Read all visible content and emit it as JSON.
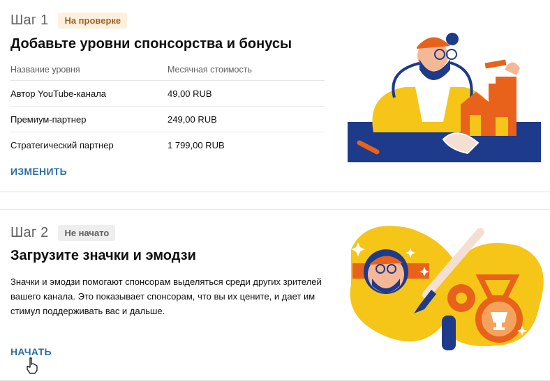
{
  "step1": {
    "step_label": "Шаг 1",
    "badge": "На проверке",
    "title": "Добавьте уровни спонсорства и бонусы",
    "table": {
      "headers": [
        "Название уровня",
        "Месячная стоимость"
      ],
      "rows": [
        [
          "Автор YouTube-канала",
          "49,00 RUB"
        ],
        [
          "Премиум-партнер",
          "249,00 RUB"
        ],
        [
          "Стратегический партнер",
          "1 799,00 RUB"
        ]
      ]
    },
    "action": "ИЗМЕНИТЬ"
  },
  "step2": {
    "step_label": "Шаг 2",
    "badge": "Не начато",
    "title": "Загрузите значки и эмодзи",
    "description": "Значки и эмодзи помогают спонсорам выделяться среди других зрителей вашего канала. Это показывает спонсорам, что вы их цените, и дает им стимул поддерживать вас и дальше.",
    "action": "НАЧАТЬ"
  },
  "colors": {
    "accent_link": "#2b6ea7",
    "badge_review_bg": "#fdf1de",
    "badge_review_text": "#a0622d",
    "badge_notstarted_bg": "#eeeeee",
    "illustration_yellow": "#f5c518",
    "illustration_orange": "#e8621c",
    "illustration_blue": "#1e3a8a"
  },
  "icons": [
    "builder-illustration",
    "badges-emoji-illustration",
    "hand-pointer-cursor-icon"
  ]
}
